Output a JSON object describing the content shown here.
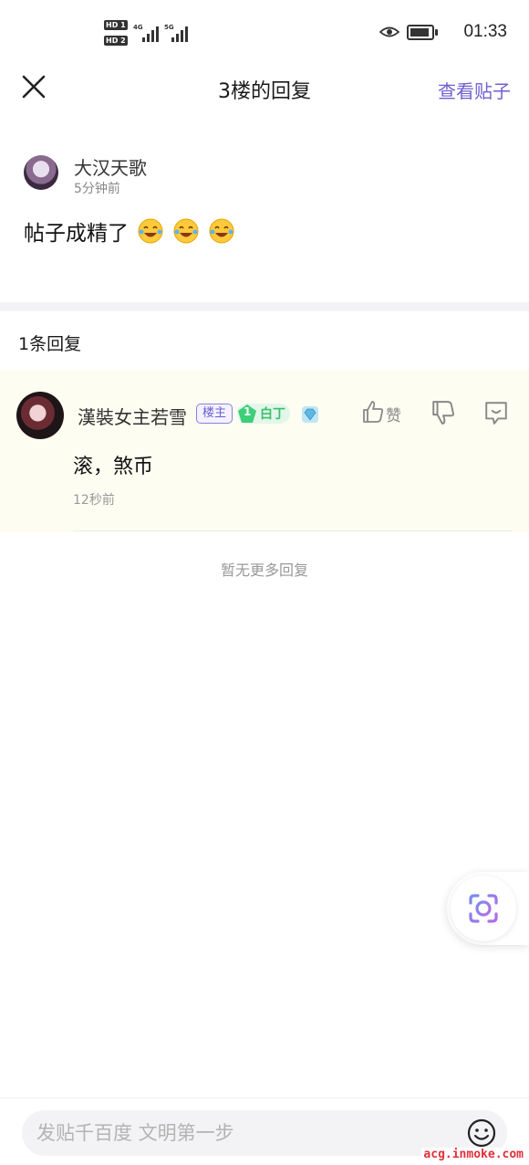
{
  "status_bar": {
    "sim1": "HD 1",
    "sim2": "HD 2",
    "net1": "4G",
    "net2": "5G",
    "time": "01:33"
  },
  "header": {
    "title": "3楼的回复",
    "view_post_label": "查看贴子"
  },
  "floor_post": {
    "author": "大汉天歌",
    "time": "5分钟前",
    "content": "帖子成精了",
    "emoji_count": 3
  },
  "replies": {
    "count_label": "1条回复",
    "items": [
      {
        "user": "漢裝女主若雪",
        "owner_badge": "楼主",
        "level_number": "1",
        "level_name": "白丁",
        "like_label": "赞",
        "text": "滚，煞币",
        "time": "12秒前"
      }
    ],
    "no_more": "暂无更多回复"
  },
  "composer": {
    "placeholder": "发贴千百度 文明第一步"
  },
  "watermark": "acg.inmoke.com",
  "colors": {
    "accent": "#6f5fcf",
    "level_green": "#3bbf6b",
    "reply_bg": "#fdfdf2"
  }
}
